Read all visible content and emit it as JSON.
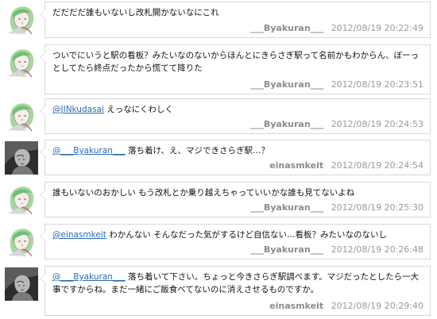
{
  "tweets": [
    {
      "avatar": "anime-green-hair-icon",
      "text": "だだだだ誰もいないし改札開かないなにこれ",
      "author": "___Byakuran___",
      "timestamp": "2012/08/19 20:22:49"
    },
    {
      "avatar": "anime-green-hair-icon",
      "text": "ついでにいうと駅の看板？みたいなのないからほんとにきらさぎ駅って名前かもわからん、ぼーっとしてたら終点だったから慌てて降りた",
      "author": "___Byakuran___",
      "timestamp": "2012/08/19 20:23:51"
    },
    {
      "avatar": "anime-green-hair-icon",
      "mention": "@JINkudasai",
      "text": " えっなにくわしく",
      "author": "___Byakuran___",
      "timestamp": "2012/08/19 20:24:53"
    },
    {
      "avatar": "grayscale-portrait-icon",
      "mention": "@___Byakuran___",
      "text": " 落ち着け、え、マジできさらぎ駅…？",
      "author": "einasmkeit",
      "timestamp": "2012/08/19 20:24:54"
    },
    {
      "avatar": "anime-green-hair-icon",
      "text": "誰もいないのおかしい もう改札とか乗り越えちゃっていいかな誰も見てないよね",
      "author": "___Byakuran___",
      "timestamp": "2012/08/19 20:25:30"
    },
    {
      "avatar": "anime-green-hair-icon",
      "mention": "@einasmkeit",
      "text": " わかんない そんなだった気がするけど自信ない…看板？みたいなのないし",
      "author": "___Byakuran___",
      "timestamp": "2012/08/19 20:26:48"
    },
    {
      "avatar": "grayscale-portrait-icon",
      "mention": "@___Byakuran___",
      "text": " 落ち着いて下さい。ちょっと今きさらぎ駅調べます。マジだったとしたら一大事ですからね。まだ一緒にご飯食べてないのに消えさせるものですか。",
      "author": "einasmkeit",
      "timestamp": "2012/08/19 20:29:40"
    }
  ]
}
